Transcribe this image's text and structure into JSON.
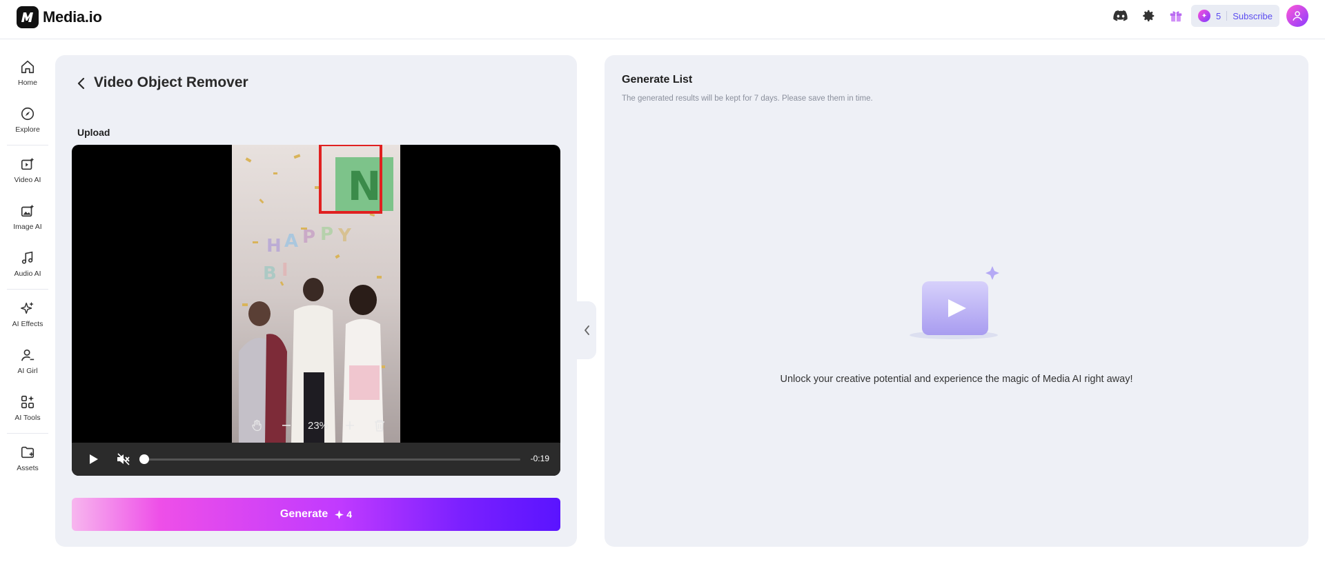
{
  "app": {
    "logo_mark": "M",
    "logo_text": "Media.io"
  },
  "topbar": {
    "icons": [
      "discord-icon",
      "settings-icon",
      "gift-icon"
    ],
    "credits": "5",
    "subscribe_label": "Subscribe"
  },
  "sidebar": {
    "items": [
      {
        "label": "Home",
        "icon": "home-icon"
      },
      {
        "label": "Explore",
        "icon": "compass-icon"
      },
      {
        "label": "Video AI",
        "icon": "video-ai-icon"
      },
      {
        "label": "Image AI",
        "icon": "image-ai-icon"
      },
      {
        "label": "Audio AI",
        "icon": "audio-ai-icon"
      },
      {
        "label": "AI Effects",
        "icon": "sparkles-icon"
      },
      {
        "label": "AI Girl",
        "icon": "ai-girl-icon"
      },
      {
        "label": "AI Tools",
        "icon": "ai-tools-icon"
      },
      {
        "label": "Assets",
        "icon": "folder-icon"
      }
    ]
  },
  "left_panel": {
    "title": "Video Object Remover",
    "upload_label": "Upload",
    "zoom_level": "23%",
    "time_remaining": "-0:19",
    "playback_progress": 0.0,
    "generate": {
      "label": "Generate",
      "cost": "4"
    }
  },
  "right_panel": {
    "title": "Generate List",
    "subtitle": "The generated results will be kept for 7 days. Please save them in time.",
    "empty_message": "Unlock your creative potential and experience the magic of Media AI right away!"
  },
  "colors": {
    "accent": "#7a20ff",
    "panel_bg": "#eef0f6",
    "mask_red": "#e02020"
  }
}
